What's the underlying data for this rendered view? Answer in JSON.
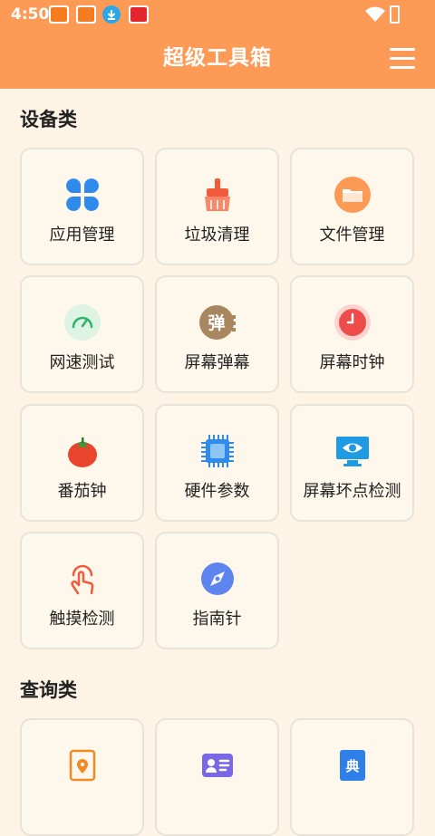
{
  "status": {
    "time": "4:50"
  },
  "header": {
    "title": "超级工具箱"
  },
  "sections": [
    {
      "title": "设备类",
      "items": [
        {
          "label": "应用管理",
          "icon": "four-petal-apps-icon"
        },
        {
          "label": "垃圾清理",
          "icon": "broom-icon"
        },
        {
          "label": "文件管理",
          "icon": "folder-icon"
        },
        {
          "label": "网速测试",
          "icon": "speedometer-icon"
        },
        {
          "label": "屏幕弹幕",
          "icon": "danmaku-icon"
        },
        {
          "label": "屏幕时钟",
          "icon": "clock-icon"
        },
        {
          "label": "番茄钟",
          "icon": "tomato-icon"
        },
        {
          "label": "硬件参数",
          "icon": "chip-icon"
        },
        {
          "label": "屏幕坏点检测",
          "icon": "monitor-eye-icon"
        },
        {
          "label": "触摸检测",
          "icon": "touch-finger-icon"
        },
        {
          "label": "指南针",
          "icon": "compass-icon"
        }
      ]
    },
    {
      "title": "查询类",
      "items": [
        {
          "label": "",
          "icon": "map-pin-icon"
        },
        {
          "label": "",
          "icon": "id-card-icon"
        },
        {
          "label": "",
          "icon": "dictionary-icon"
        }
      ]
    }
  ],
  "icon_glyphs": {
    "danmaku": "弹",
    "dictionary": "典"
  },
  "colors": {
    "header": "#FD9B56",
    "background": "#FDF4E6"
  }
}
